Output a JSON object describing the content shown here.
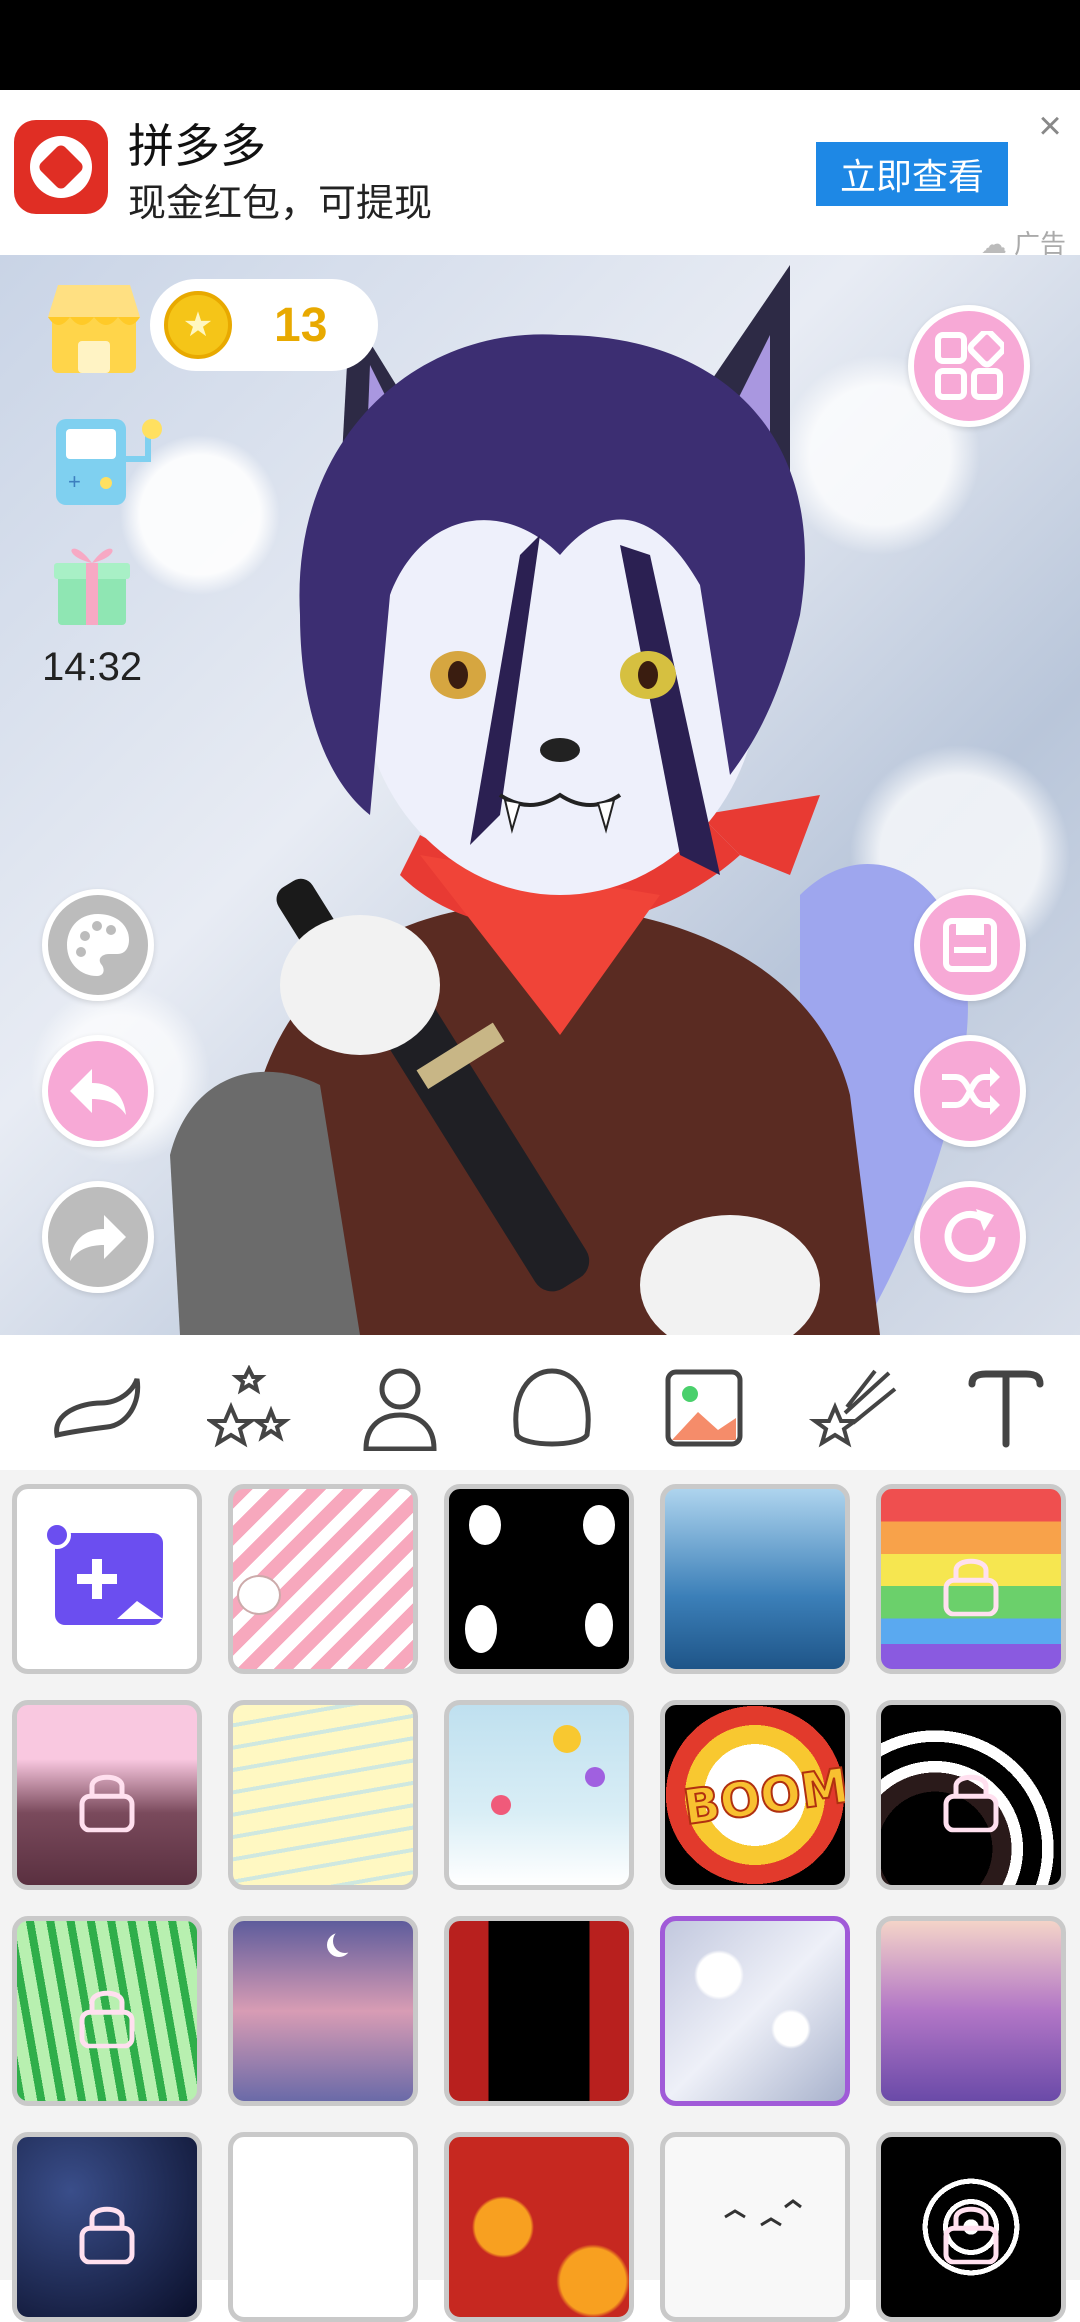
{
  "ad": {
    "title": "拼多多",
    "subtitle": "现金红包，可提现",
    "button": "立即查看",
    "close": "×",
    "tag": "广告"
  },
  "hud": {
    "coins": "13",
    "time": "14:32"
  },
  "colors": {
    "accent_pink": "#f7a9d6",
    "selected_border": "#a05ad8",
    "coin": "#f5c518",
    "ad_button": "#1e88e5"
  },
  "icons": {
    "left": [
      "shop-icon",
      "game-machine-icon",
      "gift-icon",
      "palette-icon",
      "undo-icon",
      "redo-icon"
    ],
    "right": [
      "menu-grid-icon",
      "save-icon",
      "shuffle-icon",
      "refresh-icon"
    ]
  },
  "tabs": [
    "wing-icon",
    "stars-icon",
    "person-icon",
    "head-icon",
    "background-image-icon",
    "magic-wand-icon",
    "text-icon"
  ],
  "active_tab": "background-image-icon",
  "backgrounds": [
    {
      "name": "add-custom",
      "locked": false
    },
    {
      "name": "pink-stripes",
      "locked": false
    },
    {
      "name": "ghosts",
      "locked": false
    },
    {
      "name": "underwater",
      "locked": false
    },
    {
      "name": "rainbow",
      "locked": true
    },
    {
      "name": "pink-forest",
      "locked": true
    },
    {
      "name": "yellow-waves",
      "locked": false
    },
    {
      "name": "balloons-sky",
      "locked": false
    },
    {
      "name": "boom",
      "locked": false
    },
    {
      "name": "black-swirl",
      "locked": true
    },
    {
      "name": "bamboo",
      "locked": true
    },
    {
      "name": "night-clouds",
      "locked": false
    },
    {
      "name": "red-curtain",
      "locked": false
    },
    {
      "name": "bokeh",
      "locked": false,
      "selected": true
    },
    {
      "name": "purple-sparkle",
      "locked": false
    },
    {
      "name": "starry-night",
      "locked": true
    },
    {
      "name": "white",
      "locked": false
    },
    {
      "name": "lanterns",
      "locked": false
    },
    {
      "name": "birds",
      "locked": false
    },
    {
      "name": "spider-web",
      "locked": true
    }
  ]
}
